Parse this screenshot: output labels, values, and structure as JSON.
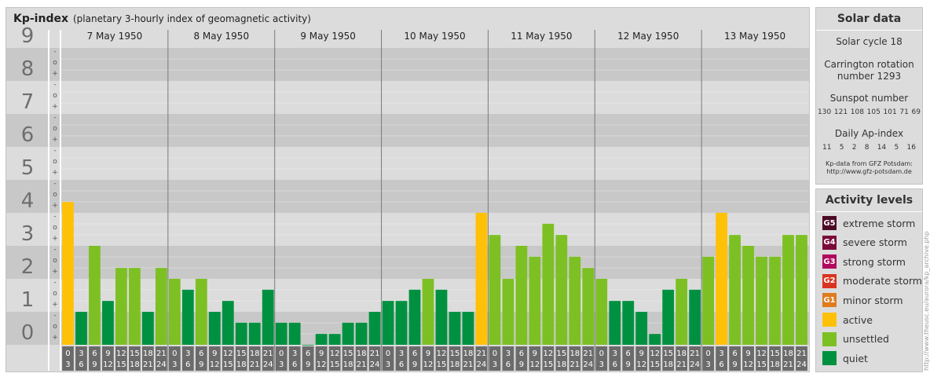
{
  "header": {
    "title": "Kp-index",
    "subtitle": "(planetary 3-hourly index of geomagnetic activity)"
  },
  "colors": {
    "quiet": "#009140",
    "unsettled": "#7dc023",
    "active": "#ffc107",
    "minor_storm": "#e07b1c",
    "moderate_storm": "#d9341f",
    "strong_storm": "#b0085e",
    "severe_storm": "#7b0a3a",
    "extreme_storm": "#4d0a26"
  },
  "chart_data": {
    "type": "bar",
    "ylim": [
      0,
      9
    ],
    "y_ticks": [
      "0",
      "1",
      "2",
      "3",
      "4",
      "5",
      "6",
      "7",
      "8",
      "9"
    ],
    "minor_tick_marks": [
      "+",
      "o",
      "-"
    ],
    "days": [
      "7 May 1950",
      "8 May 1950",
      "9 May 1950",
      "10 May 1950",
      "11 May 1950",
      "12 May 1950",
      "13 May 1950"
    ],
    "interval_labels": [
      [
        "0",
        "3"
      ],
      [
        "3",
        "6"
      ],
      [
        "6",
        "9"
      ],
      [
        "9",
        "12"
      ],
      [
        "12",
        "15"
      ],
      [
        "15",
        "18"
      ],
      [
        "18",
        "21"
      ],
      [
        "21",
        "24"
      ]
    ],
    "values": [
      4.33,
      1.0,
      3.0,
      1.33,
      2.33,
      2.33,
      1.0,
      2.33,
      2.0,
      1.67,
      2.0,
      1.0,
      1.33,
      0.67,
      0.67,
      1.67,
      0.67,
      0.67,
      0.0,
      0.33,
      0.33,
      0.67,
      0.67,
      1.0,
      1.33,
      1.33,
      1.67,
      2.0,
      1.67,
      1.0,
      1.0,
      4.0,
      3.33,
      2.0,
      3.0,
      2.67,
      3.67,
      3.33,
      2.67,
      2.33,
      2.0,
      1.33,
      1.33,
      1.0,
      0.33,
      1.67,
      2.0,
      1.67,
      2.67,
      4.0,
      3.33,
      3.0,
      2.67,
      2.67,
      3.33,
      3.33
    ]
  },
  "solar": {
    "title": "Solar data",
    "cycle": "Solar cycle 18",
    "carrington_line1": "Carrington rotation",
    "carrington_line2": "number 1293",
    "sunspot_label": "Sunspot number",
    "sunspot_values": [
      "130",
      "121",
      "108",
      "105",
      "101",
      "71",
      "69"
    ],
    "ap_label": "Daily Ap-index",
    "ap_values": [
      "11",
      "5",
      "2",
      "8",
      "14",
      "5",
      "16"
    ],
    "source_line1": "Kp-data from GFZ Potsdam:",
    "source_line2": "http://www.gfz-potsdam.de"
  },
  "activity": {
    "title": "Activity levels",
    "levels": [
      {
        "badge": "G5",
        "label": "extreme storm",
        "color": "#4d0a26"
      },
      {
        "badge": "G4",
        "label": "severe storm",
        "color": "#7b0a3a"
      },
      {
        "badge": "G3",
        "label": "strong storm",
        "color": "#b0085e"
      },
      {
        "badge": "G2",
        "label": "moderate storm",
        "color": "#d9341f"
      },
      {
        "badge": "G1",
        "label": "minor storm",
        "color": "#e07b1c"
      },
      {
        "badge": "",
        "label": "active",
        "color": "#ffc107"
      },
      {
        "badge": "",
        "label": "unsettled",
        "color": "#7dc023"
      },
      {
        "badge": "",
        "label": "quiet",
        "color": "#009140"
      }
    ]
  },
  "credit": "http://www.theusc.eu/aurora/kp_archive.php"
}
